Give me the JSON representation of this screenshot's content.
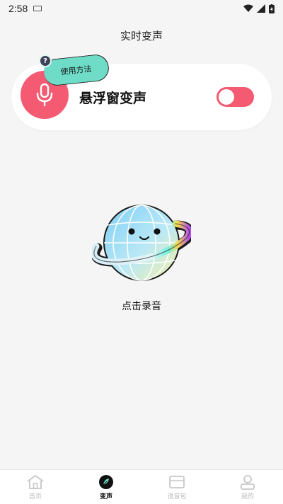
{
  "status": {
    "time": "2:58"
  },
  "page": {
    "title": "实时变声"
  },
  "floating": {
    "label": "悬浮窗变声",
    "help_label": "使用方法",
    "help_icon": "?",
    "toggle_on": true
  },
  "record": {
    "label": "点击录音"
  },
  "tabs": [
    {
      "label": "首页",
      "icon": "home-icon",
      "active": false
    },
    {
      "label": "变声",
      "icon": "leaf-icon",
      "active": true
    },
    {
      "label": "语音包",
      "icon": "package-icon",
      "active": false
    },
    {
      "label": "我的",
      "icon": "user-icon",
      "active": false
    }
  ],
  "colors": {
    "accent": "#f45a72",
    "help": "#6fdcc8"
  }
}
